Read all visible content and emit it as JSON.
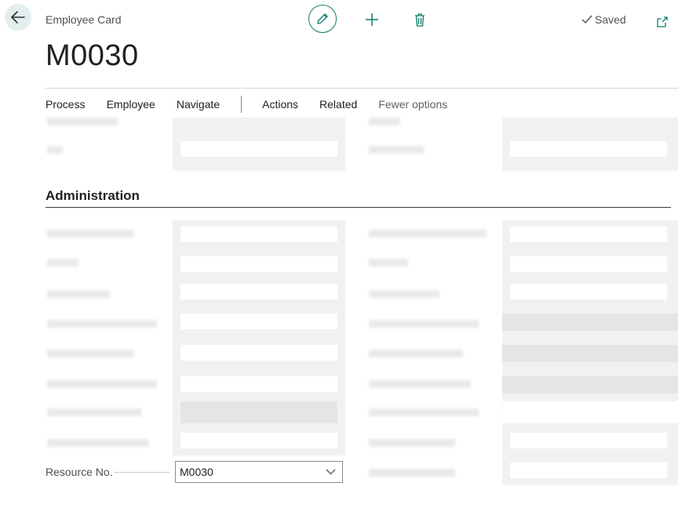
{
  "header": {
    "page_kind": "Employee Card",
    "saved_label": "Saved",
    "record_title": "M0030"
  },
  "actionbar": {
    "items": [
      "Process",
      "Employee",
      "Navigate",
      "Actions",
      "Related",
      "Fewer options"
    ]
  },
  "section": {
    "title": "Administration"
  },
  "fields": {
    "resource_no_label": "Resource No.",
    "resource_no_value": "M0030"
  },
  "colors": {
    "accent": "#0f7b6c",
    "back_bg": "#e3eeee"
  },
  "icons": [
    "back-arrow-icon",
    "edit-pencil-icon",
    "plus-icon",
    "trash-icon",
    "checkmark-icon",
    "popout-icon",
    "chevron-down-icon"
  ]
}
